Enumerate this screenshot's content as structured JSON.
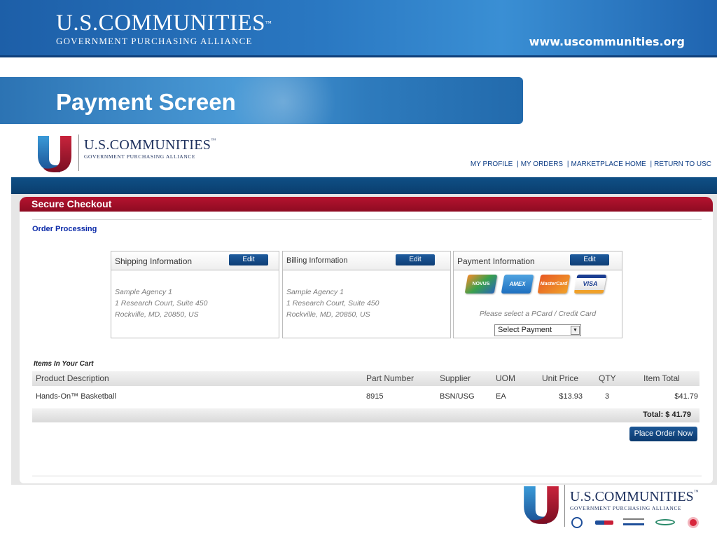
{
  "banner": {
    "logo_big": "U.S.COMMUNITIES",
    "logo_tm": "™",
    "logo_small": "GOVERNMENT PURCHASING ALLIANCE",
    "url": "www.uscommunities.org"
  },
  "page_title": "Payment Screen",
  "site": {
    "logo_big": "U.S.COMMUNITIES",
    "logo_tm": "™",
    "logo_small": "GOVERNMENT PURCHASING ALLIANCE",
    "nav": [
      {
        "label": "MY PROFILE"
      },
      {
        "label": "MY ORDERS"
      },
      {
        "label": "MARKETPLACE HOME"
      },
      {
        "label": "RETURN TO USC"
      }
    ],
    "nav_separator": "|"
  },
  "checkout": {
    "bar_label": "Secure Checkout",
    "section_label": "Order Processing"
  },
  "panels": {
    "shipping": {
      "title": "Shipping Information",
      "edit_label": "Edit",
      "lines": [
        "Sample Agency 1",
        "1 Research Court, Suite 450",
        "Rockville, MD, 20850, US"
      ]
    },
    "billing": {
      "title": "Billing Information",
      "edit_label": "Edit",
      "lines": [
        "Sample Agency 1",
        "1 Research Court, Suite 450",
        "Rockville, MD, 20850, US"
      ]
    },
    "payment": {
      "title": "Payment Information",
      "edit_label": "Edit",
      "cards": [
        "NOVUS",
        "AMEX",
        "MasterCard",
        "VISA"
      ],
      "hint": "Please select a PCard / Credit Card",
      "select_value": "Select Payment",
      "select_arrow": "▼"
    }
  },
  "cart": {
    "title": "Items In Your Cart",
    "columns": [
      "Product Description",
      "Part Number",
      "Supplier",
      "UOM",
      "Unit Price",
      "QTY",
      "Item Total"
    ],
    "rows": [
      {
        "description": "Hands-On™ Basketball",
        "part_number": "8915",
        "supplier": "BSN/USG",
        "uom": "EA",
        "unit_price": "$13.93",
        "qty": "3",
        "item_total": "$41.79"
      }
    ],
    "total": "Total: $ 41.79",
    "place_order_label": "Place Order Now"
  },
  "footer": {
    "logo_big": "U.S.COMMUNITIES",
    "logo_tm": "™",
    "logo_small": "GOVERNMENT PURCHASING ALLIANCE",
    "sponsor_icons": [
      "naco-seal-icon",
      "us-mayors-icon",
      "national-league-icon",
      "nigp-icon",
      "asbo-icon"
    ]
  },
  "colors": {
    "banner_blue": "#2a78c2",
    "nav_dark": "#0a3e6d",
    "checkout_red": "#a01028",
    "link_blue": "#0d3d85",
    "section_blue": "#0b2aa8"
  }
}
